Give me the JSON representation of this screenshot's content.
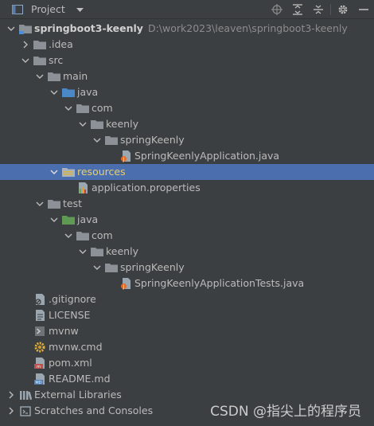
{
  "toolbar": {
    "title": "Project",
    "icons": [
      "project-panel-icon",
      "locate-icon",
      "expand-all-icon",
      "collapse-all-icon",
      "settings-icon",
      "hide-icon"
    ]
  },
  "tree": {
    "root_name": "springboot3-keenly",
    "root_path": "D:\\work2023\\leaven\\springboot3-keenly",
    "idea": ".idea",
    "src": "src",
    "main": "main",
    "java": "java",
    "com": "com",
    "keenly": "keenly",
    "springKeenly": "springKeenly",
    "app_class": "SpringKeenlyApplication.java",
    "resources": "resources",
    "app_props": "application.properties",
    "test": "test",
    "test_java": "java",
    "test_com": "com",
    "test_keenly": "keenly",
    "test_springKeenly": "springKeenly",
    "test_class": "SpringKeenlyApplicationTests.java",
    "gitignore": ".gitignore",
    "license": "LICENSE",
    "mvnw": "mvnw",
    "mvnw_cmd": "mvnw.cmd",
    "pom": "pom.xml",
    "readme": "README.md",
    "external_libraries": "External Libraries",
    "scratches": "Scratches and Consoles"
  },
  "watermark": "CSDN @指尖上的程序员",
  "colors": {
    "background": "#3c3f41",
    "selection": "#4b6eaf",
    "folder": "#8c9198",
    "resources_text": "#d0b75a"
  }
}
